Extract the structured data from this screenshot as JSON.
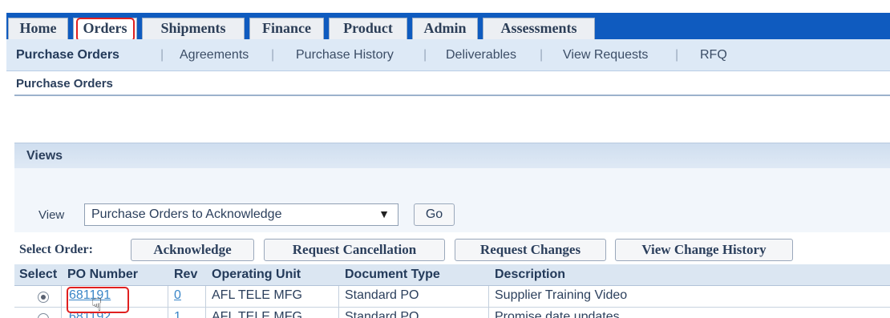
{
  "tabs": [
    {
      "label": "Home",
      "active": false
    },
    {
      "label": "Orders",
      "active": true
    },
    {
      "label": "Shipments",
      "active": false
    },
    {
      "label": "Finance",
      "active": false
    },
    {
      "label": "Product",
      "active": false
    },
    {
      "label": "Admin",
      "active": false
    },
    {
      "label": "Assessments",
      "active": false
    }
  ],
  "subnav": [
    {
      "label": "Purchase Orders"
    },
    {
      "label": "Agreements"
    },
    {
      "label": "Purchase History"
    },
    {
      "label": "Deliverables"
    },
    {
      "label": "View Requests"
    },
    {
      "label": "RFQ"
    }
  ],
  "page_title": "Purchase Orders",
  "views": {
    "header": "Views",
    "view_label": "View",
    "selected_view": "Purchase Orders to Acknowledge",
    "go_label": "Go"
  },
  "select_order": {
    "label": "Select Order:",
    "buttons": [
      "Acknowledge",
      "Request Cancellation",
      "Request Changes",
      "View Change History"
    ]
  },
  "table": {
    "headers": [
      "Select",
      "PO Number",
      "Rev",
      "Operating Unit",
      "Document Type",
      "Description"
    ],
    "rows": [
      {
        "selected": true,
        "po_number": "681191",
        "rev": "0",
        "operating_unit": "AFL TELE MFG",
        "document_type": "Standard PO",
        "description": "Supplier Training Video"
      },
      {
        "selected": false,
        "po_number": "681192",
        "rev": "1",
        "operating_unit": "AFL TELE MFG",
        "document_type": "Standard PO",
        "description": "Promise date updates"
      }
    ]
  },
  "colors": {
    "tab_bar": "#0f5bbf",
    "highlight": "#e02020",
    "link": "#3a86c8"
  }
}
